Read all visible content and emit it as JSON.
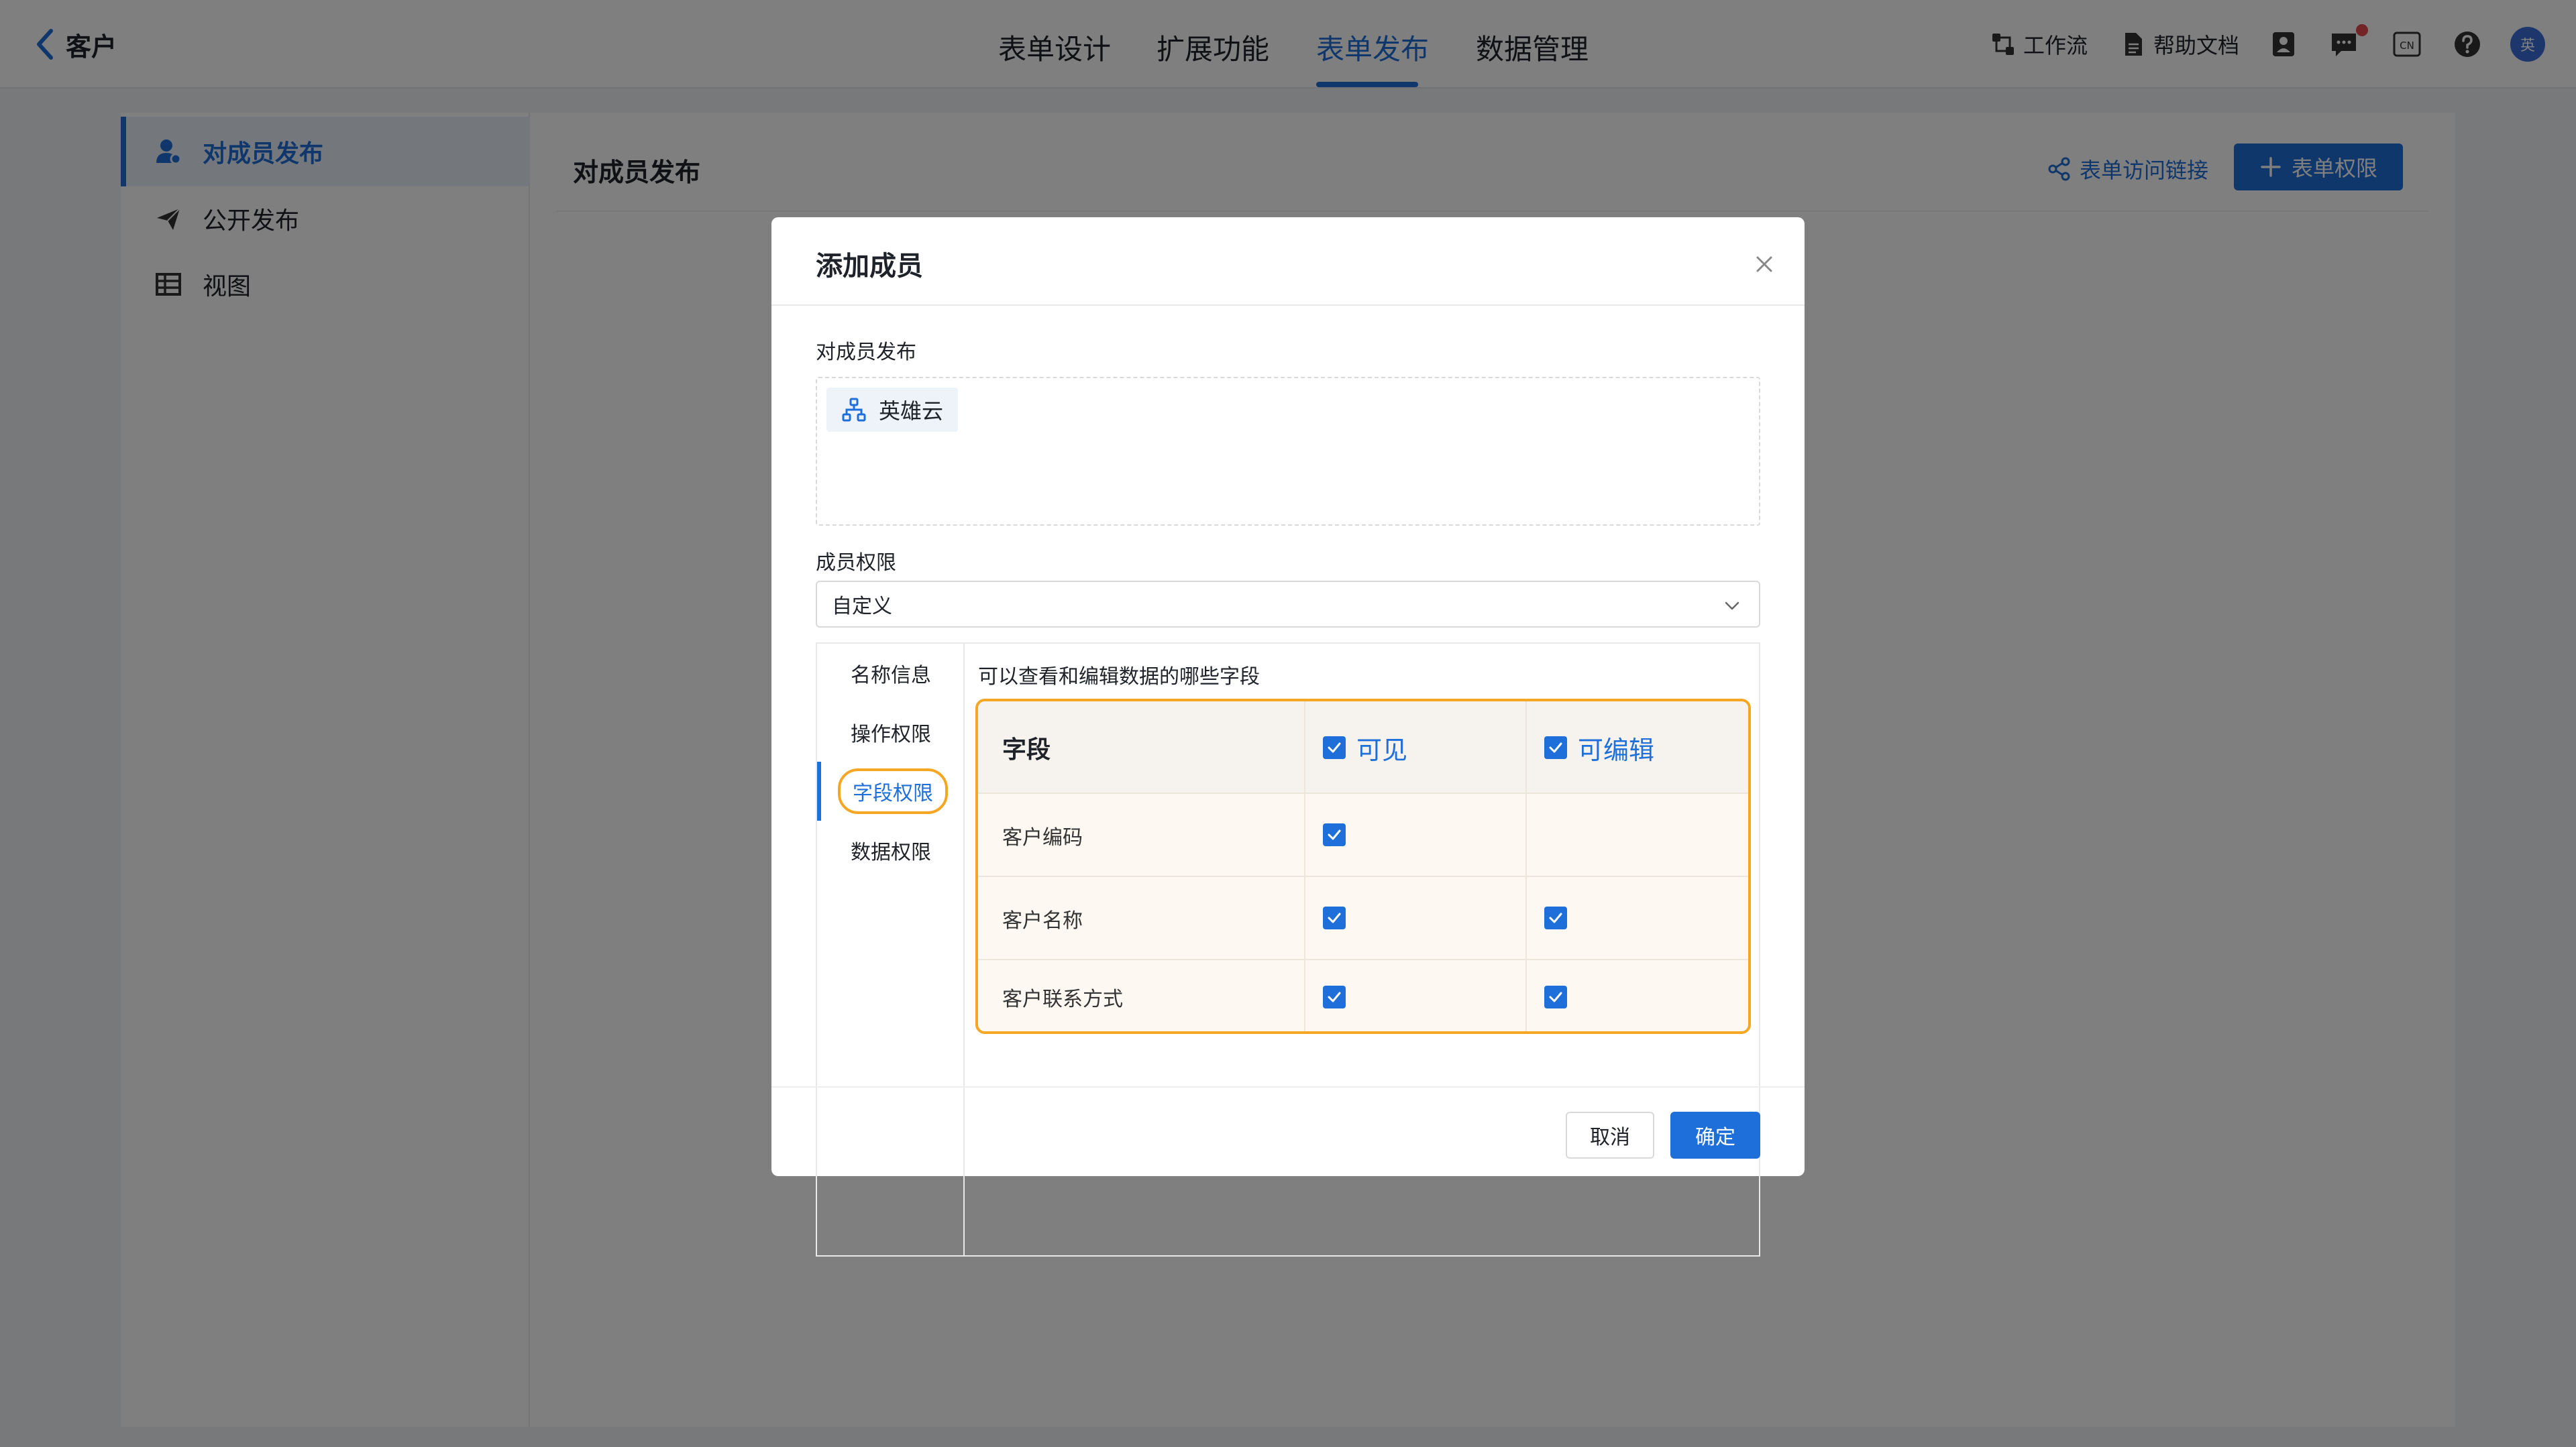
{
  "header": {
    "back_label": "客户",
    "tabs": [
      {
        "label": "表单设计"
      },
      {
        "label": "扩展功能"
      },
      {
        "label": "表单发布"
      },
      {
        "label": "数据管理"
      }
    ],
    "active_tab": "表单发布",
    "tools": {
      "workflow": "工作流",
      "help_docs": "帮助文档",
      "lang": "CN"
    },
    "avatar_text": "英"
  },
  "sidebar": {
    "items": [
      {
        "label": "对成员发布",
        "icon": "member-icon",
        "active": true
      },
      {
        "label": "公开发布",
        "icon": "send-icon",
        "active": false
      },
      {
        "label": "视图",
        "icon": "table-icon",
        "active": false
      }
    ]
  },
  "content": {
    "title": "对成员发布",
    "link_label": "表单访问链接",
    "permission_button": "表单权限"
  },
  "modal": {
    "title": "添加成员",
    "members_label": "对成员发布",
    "member_tags": [
      "英雄云"
    ],
    "permission_label": "成员权限",
    "permission_value": "自定义",
    "perm_tabs": [
      "名称信息",
      "操作权限",
      "字段权限",
      "数据权限"
    ],
    "active_perm_tab": "字段权限",
    "description": "可以查看和编辑数据的哪些字段",
    "table": {
      "headers": {
        "field": "字段",
        "visible": "可见",
        "editable": "可编辑"
      },
      "header_visible_checked": true,
      "header_editable_checked": true,
      "rows": [
        {
          "name": "客户编码",
          "visible": true,
          "editable": null
        },
        {
          "name": "客户名称",
          "visible": true,
          "editable": true
        },
        {
          "name": "客户联系方式",
          "visible": true,
          "editable": true
        }
      ]
    },
    "cancel_label": "取消",
    "ok_label": "确定"
  },
  "colors": {
    "accent": "#1e6fd9",
    "highlight": "#f5a623",
    "overlay": "rgba(0,0,0,0.5)"
  }
}
